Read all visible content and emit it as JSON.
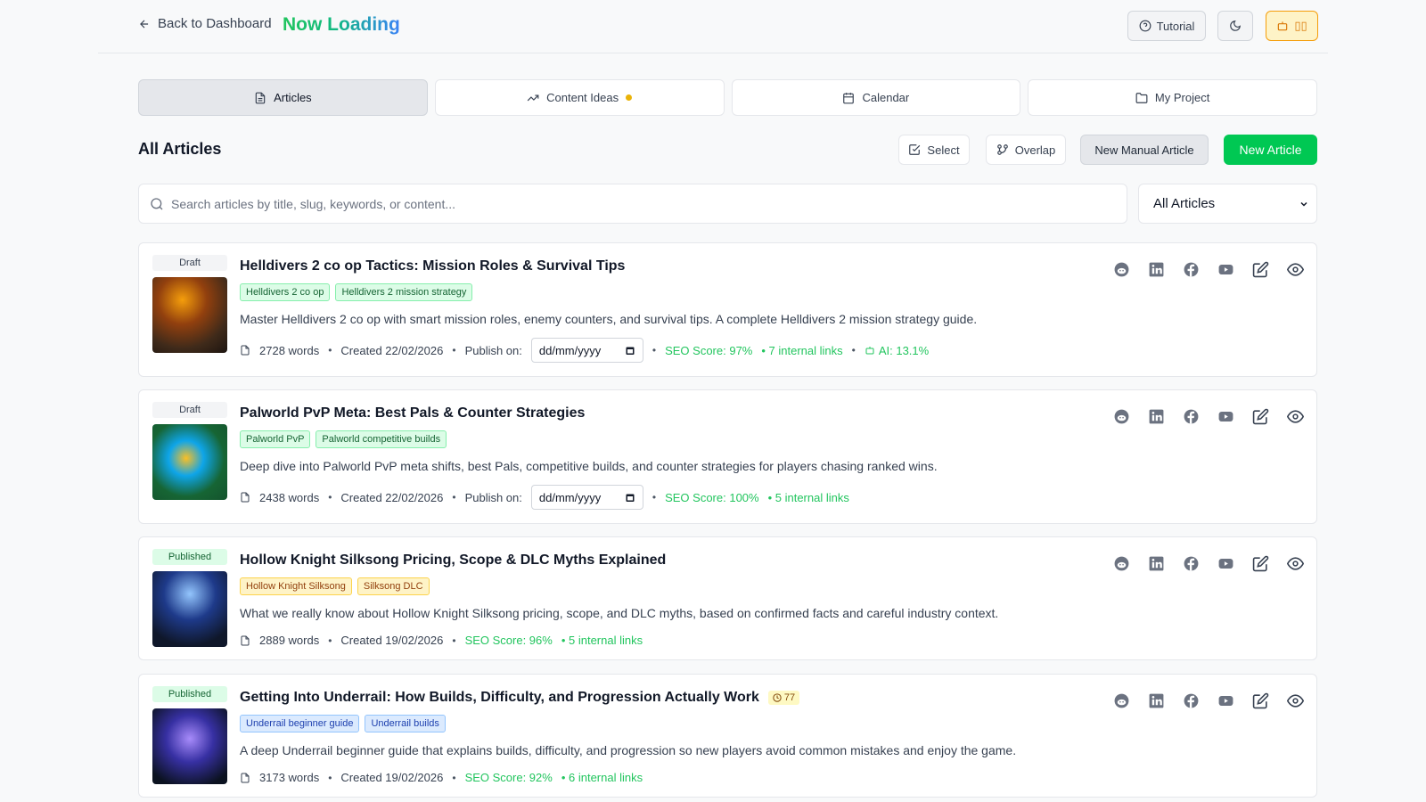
{
  "header": {
    "back_label": "Back to Dashboard",
    "brand": "Now Loading",
    "tutorial_label": "Tutorial",
    "ai_label": "▯▯"
  },
  "tabs": [
    {
      "label": "Articles",
      "icon": "file-icon",
      "active": true
    },
    {
      "label": "Content Ideas",
      "icon": "trending-icon",
      "active": false,
      "indicator": true
    },
    {
      "label": "Calendar",
      "icon": "calendar-icon",
      "active": false
    },
    {
      "label": "My Project",
      "icon": "folder-icon",
      "active": false
    }
  ],
  "toolbar": {
    "title": "All Articles",
    "select_label": "Select",
    "overlap_label": "Overlap",
    "manual_label": "New Manual Article",
    "new_label": "New Article"
  },
  "search": {
    "placeholder": "Search articles by title, slug, keywords, or content...",
    "filter_value": "All Articles"
  },
  "colors": {
    "accent_green": "#00c853",
    "seo_green": "#22c55e",
    "brand_blue": "#3b82f6"
  },
  "articles": [
    {
      "status": "Draft",
      "title": "Helldivers 2 co op Tactics: Mission Roles & Survival Tips",
      "tags": [
        "Helldivers 2 co op",
        "Helldivers 2 mission strategy"
      ],
      "description": "Master Helldivers 2 co op with smart mission roles, enemy counters, and survival tips. A complete Helldivers 2 mission strategy guide.",
      "words": "2728 words",
      "created": "Created 22/02/2026",
      "publish_label": "Publish on:",
      "publish_placeholder": "dd/mm/yyyy",
      "seo": "SEO Score: 97%",
      "links": "• 7 internal links",
      "ai": "AI: 13.1%"
    },
    {
      "status": "Draft",
      "title": "Palworld PvP Meta: Best Pals & Counter Strategies",
      "tags": [
        "Palworld PvP",
        "Palworld competitive builds"
      ],
      "description": "Deep dive into Palworld PvP meta shifts, best Pals, competitive builds, and counter strategies for players chasing ranked wins.",
      "words": "2438 words",
      "created": "Created 22/02/2026",
      "publish_label": "Publish on:",
      "publish_placeholder": "dd/mm/yyyy",
      "seo": "SEO Score: 100%",
      "links": "• 5 internal links"
    },
    {
      "status": "Published",
      "title": "Hollow Knight Silksong Pricing, Scope & DLC Myths Explained",
      "tags": [
        "Hollow Knight Silksong",
        "Silksong DLC"
      ],
      "description": "What we really know about Hollow Knight Silksong pricing, scope, and DLC myths, based on confirmed facts and careful industry context.",
      "words": "2889 words",
      "created": "Created 19/02/2026",
      "seo": "SEO Score: 96%",
      "links": "• 5 internal links"
    },
    {
      "status": "Published",
      "title": "Getting Into Underrail: How Builds, Difficulty, and Progression Actually Work",
      "views": "77",
      "tags": [
        "Underrail beginner guide",
        "Underrail builds"
      ],
      "description": "A deep Underrail beginner guide that explains builds, difficulty, and progression so new players avoid common mistakes and enjoy the game.",
      "words": "3173 words",
      "created": "Created 19/02/2026",
      "seo": "SEO Score: 92%",
      "links": "• 6 internal links"
    }
  ]
}
